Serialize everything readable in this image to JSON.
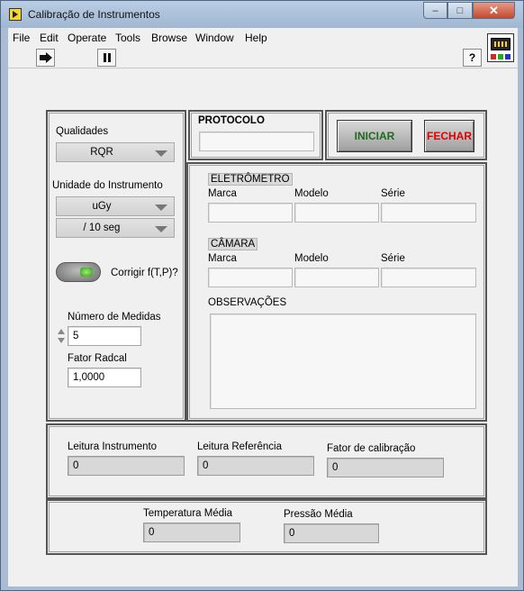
{
  "window": {
    "title": "Calibração de Instrumentos",
    "minimize": "–",
    "maximize": "□",
    "close": "✕"
  },
  "menu": [
    {
      "label": "File"
    },
    {
      "label": "Edit"
    },
    {
      "label": "Operate"
    },
    {
      "label": "Tools"
    },
    {
      "label": "Browse"
    },
    {
      "label": "Window"
    },
    {
      "label": "Help"
    }
  ],
  "toolbar": {
    "run_icon": "run-arrow-icon",
    "pause_icon": "pause-icon",
    "help_label": "?"
  },
  "left_panel": {
    "qualidades_label": "Qualidades",
    "qualidades_value": "RQR",
    "unidade_label": "Unidade do Instrumento",
    "unidade_value": "uGy",
    "tempo_value": "/ 10 seg",
    "corrigir_label": "Corrigir f(T,P)?",
    "corrigir_state": true,
    "num_medidas_label": "Número de Medidas",
    "num_medidas_value": "5",
    "fator_radcal_label": "Fator Radcal",
    "fator_radcal_value": "1,0000"
  },
  "protocolo": {
    "label": "PROTOCOLO",
    "value": ""
  },
  "buttons": {
    "iniciar": "INICIAR",
    "fechar": "FECHAR",
    "iniciar_color": "#1e6a1e",
    "fechar_color": "#e00000"
  },
  "eletrometro": {
    "label": "ELETRÔMETRO",
    "marca_label": "Marca",
    "modelo_label": "Modelo",
    "serie_label": "Série",
    "marca": "",
    "modelo": "",
    "serie": ""
  },
  "camara": {
    "label": "CÂMARA",
    "marca_label": "Marca",
    "modelo_label": "Modelo",
    "serie_label": "Série",
    "marca": "",
    "modelo": "",
    "serie": ""
  },
  "observacoes": {
    "label": "OBSERVAÇÕES",
    "value": ""
  },
  "results": {
    "leitura_instrumento_label": "Leitura Instrumento",
    "leitura_instrumento": "0",
    "leitura_referencia_label": "Leitura Referência",
    "leitura_referencia": "0",
    "fator_calibracao_label": "Fator de calibração",
    "fator_calibracao": "0"
  },
  "ambient": {
    "temperatura_label": "Temperatura Média",
    "temperatura": "0",
    "pressao_label": "Pressão Média",
    "pressao": "0"
  }
}
